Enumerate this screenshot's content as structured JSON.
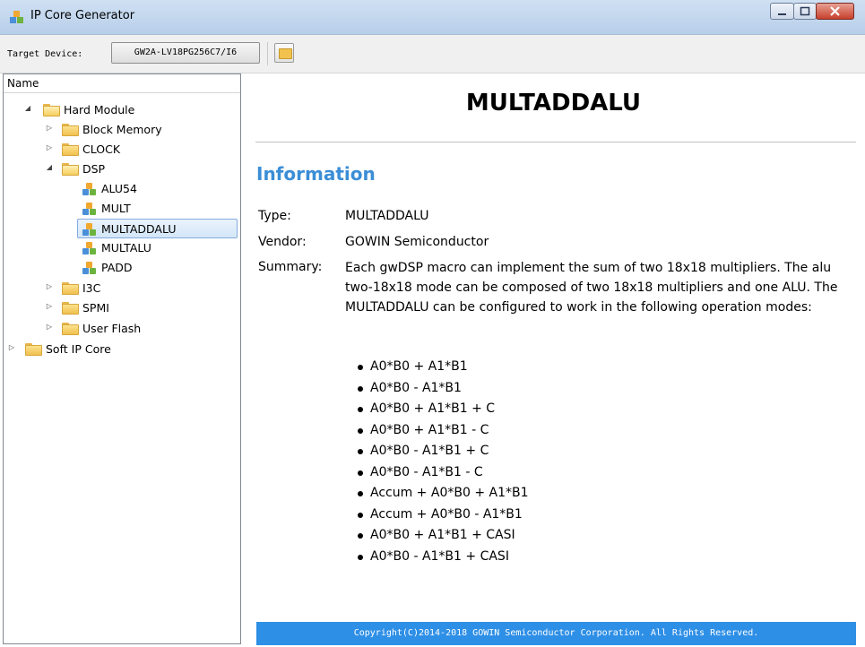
{
  "window": {
    "title": "IP Core Generator"
  },
  "toolbar": {
    "target_label": "Target Device:",
    "device_value": "GW2A-LV18PG256C7/I6"
  },
  "tree": {
    "header": "Name",
    "nodes": {
      "hard_module": "Hard Module",
      "block_memory": "Block Memory",
      "clock": "CLOCK",
      "dsp": "DSP",
      "alu54": "ALU54",
      "mult": "MULT",
      "multaddalu": "MULTADDALU",
      "multalu": "MULTALU",
      "padd": "PADD",
      "i3c": "I3C",
      "spmi": "SPMI",
      "user_flash": "User Flash",
      "soft_ip_core": "Soft IP Core"
    }
  },
  "content": {
    "title": "MULTADDALU",
    "info_heading": "Information",
    "type_label": "Type:",
    "type_value": "MULTADDALU",
    "vendor_label": "Vendor:",
    "vendor_value": "GOWIN Semiconductor",
    "summary_label": "Summary:",
    "summary_text": "Each gwDSP macro can implement the sum of two 18x18 multipliers. The alu two-18x18 mode can be composed of two 18x18 multipliers and one ALU. The MULTADDALU can be configured to work in the following operation modes:",
    "modes": [
      "A0*B0 + A1*B1",
      "A0*B0 - A1*B1",
      "A0*B0 + A1*B1 + C",
      "A0*B0 + A1*B1 - C",
      "A0*B0 - A1*B1 + C",
      "A0*B0 - A1*B1 - C",
      "Accum + A0*B0 + A1*B1",
      "Accum + A0*B0 - A1*B1",
      "A0*B0 + A1*B1 + CASI",
      "A0*B0 - A1*B1 + CASI"
    ],
    "footer": "Copyright(C)2014-2018 GOWIN Semiconductor Corporation. All Rights Reserved."
  },
  "colors": {
    "accent": "#3b8ed6",
    "footer_bg": "#2e8fe6",
    "selection": "#d3e6f8"
  }
}
